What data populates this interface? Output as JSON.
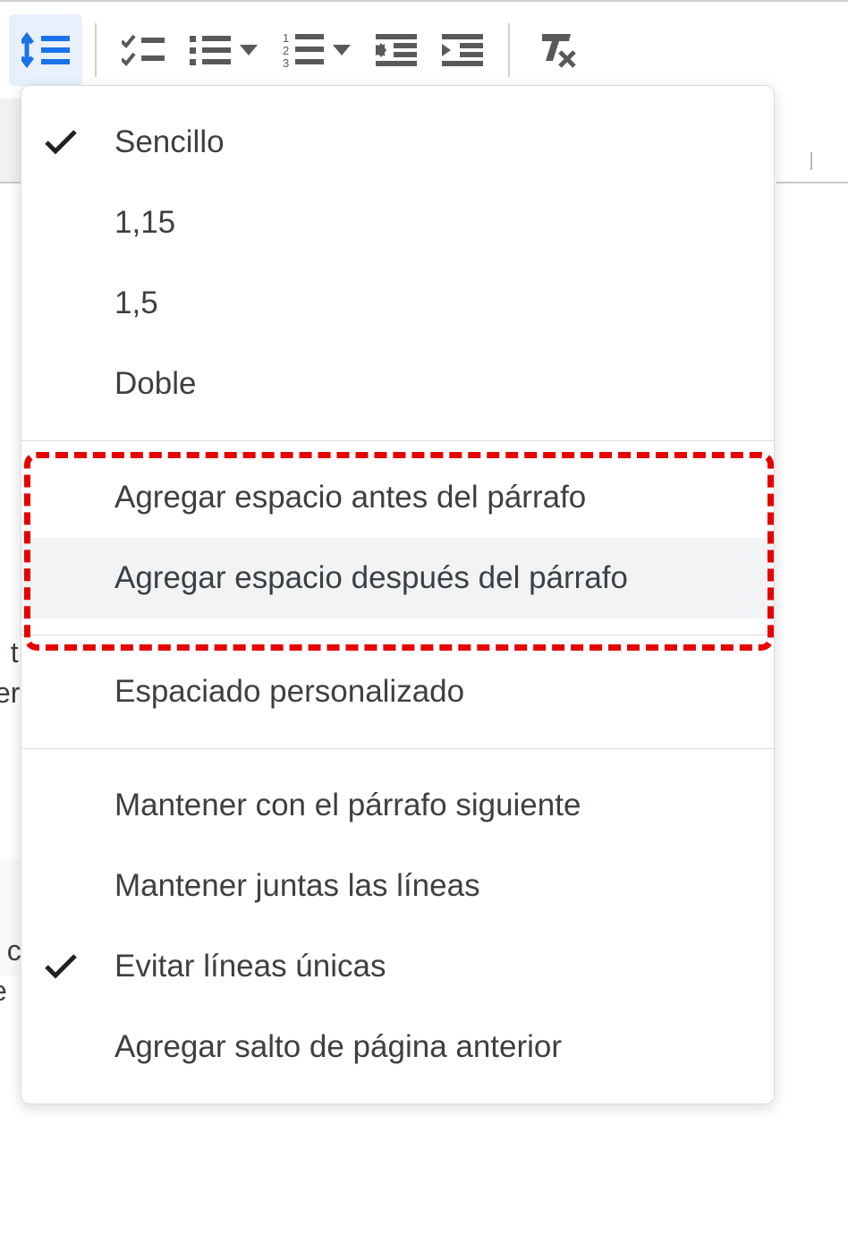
{
  "toolbar": {
    "line_spacing_btn": "line-spacing",
    "checklist_btn": "checklist",
    "bulleted_btn": "bulleted-list",
    "numbered_btn": "numbered-list",
    "indent_decrease_btn": "decrease-indent",
    "indent_increase_btn": "increase-indent",
    "clear_format_btn": "clear-formatting"
  },
  "menu": {
    "items": [
      {
        "label": "Sencillo",
        "checked": true
      },
      {
        "label": "1,15",
        "checked": false
      },
      {
        "label": "1,5",
        "checked": false
      },
      {
        "label": "Doble",
        "checked": false
      }
    ],
    "space_before": "Agregar espacio antes del párrafo",
    "space_after": "Agregar espacio después del párrafo",
    "custom_spacing": "Espaciado personalizado",
    "keep_with_next": "Mantener con el párrafo siguiente",
    "keep_lines": "Mantener juntas las líneas",
    "avoid_widow": {
      "label": "Evitar líneas únicas",
      "checked": true
    },
    "page_break_before": "Agregar salto de página anterior"
  },
  "background": {
    "frag1_line1": "t.",
    "frag1_line2": "er",
    "frag2_line1": "co",
    "frag2_line2": "e"
  }
}
